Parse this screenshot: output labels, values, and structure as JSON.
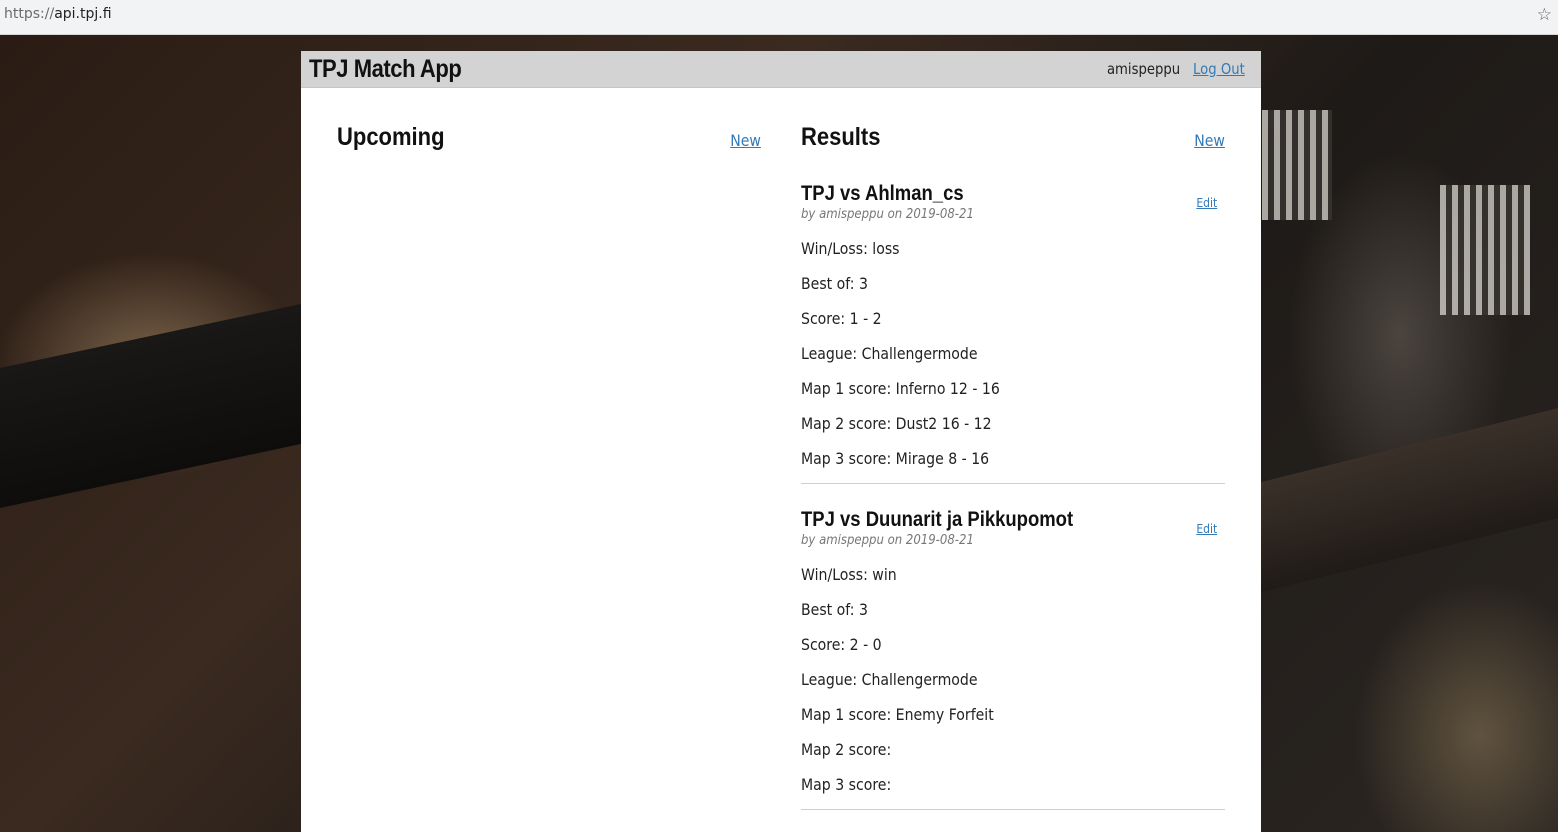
{
  "browser": {
    "url_scheme": "https://",
    "url_host": "api.tpj.fi",
    "bookmark_icon": "star-icon"
  },
  "header": {
    "title": "TPJ Match App",
    "username": "amispeppu",
    "logout_label": "Log Out"
  },
  "upcoming": {
    "heading": "Upcoming",
    "new_label": "New"
  },
  "results": {
    "heading": "Results",
    "new_label": "New",
    "matches": [
      {
        "title": "TPJ vs Ahlman_cs",
        "meta": "by amispeppu on 2019-08-21",
        "edit_label": "Edit",
        "fields": [
          {
            "label": "Win/Loss:",
            "value": "loss"
          },
          {
            "label": "Best of:",
            "value": "3"
          },
          {
            "label": "Score:",
            "value": "1 - 2"
          },
          {
            "label": "League:",
            "value": "Challengermode"
          },
          {
            "label": "Map 1 score:",
            "value": "Inferno 12 - 16"
          },
          {
            "label": "Map 2 score:",
            "value": "Dust2 16 - 12"
          },
          {
            "label": "Map 3 score:",
            "value": "Mirage 8 - 16"
          }
        ]
      },
      {
        "title": "TPJ vs Duunarit ja Pikkupomot",
        "meta": "by amispeppu on 2019-08-21",
        "edit_label": "Edit",
        "fields": [
          {
            "label": "Win/Loss:",
            "value": "win"
          },
          {
            "label": "Best of:",
            "value": "3"
          },
          {
            "label": "Score:",
            "value": "2 - 0"
          },
          {
            "label": "League:",
            "value": "Challengermode"
          },
          {
            "label": "Map 1 score:",
            "value": "Enemy Forfeit"
          },
          {
            "label": "Map 2 score:",
            "value": ""
          },
          {
            "label": "Map 3 score:",
            "value": ""
          }
        ]
      }
    ]
  },
  "colors": {
    "link": "#337ab7",
    "header_bg": "#d3d3d3",
    "panel_bg": "#ffffff"
  }
}
